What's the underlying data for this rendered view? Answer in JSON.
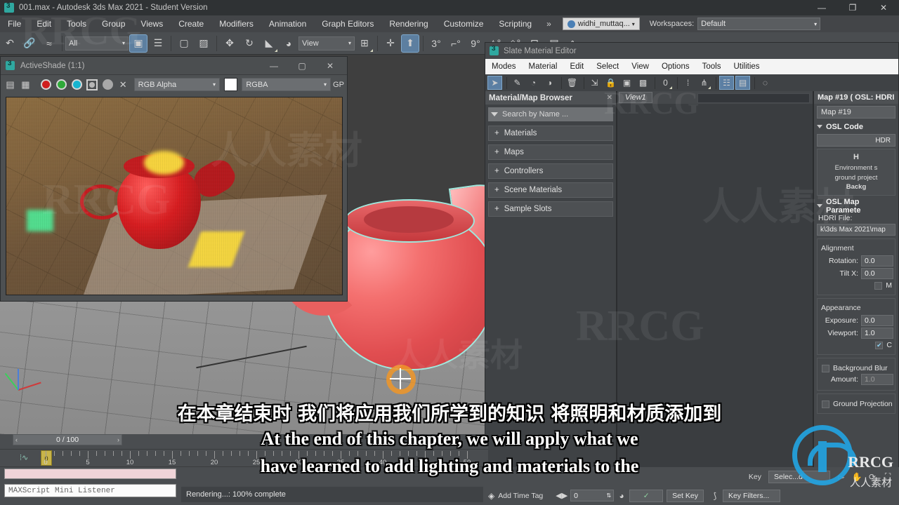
{
  "window": {
    "title": "001.max - Autodesk 3ds Max 2021 - Student Version",
    "minimize": "—",
    "maximize": "❐",
    "close": "✕"
  },
  "menubar": {
    "items": [
      "File",
      "Edit",
      "Tools",
      "Group",
      "Views",
      "Create",
      "Modifiers",
      "Animation",
      "Graph Editors",
      "Rendering",
      "Customize",
      "Scripting"
    ],
    "overflow": "»",
    "user": "widhi_muttaq...",
    "user_arrow": "▾",
    "workspaces_label": "Workspaces:",
    "workspace_value": "Default",
    "workspace_arrow": "▾"
  },
  "main_toolbar": {
    "selection_filter": "All",
    "filter_arrow": "▾",
    "reference_coordinate": "View",
    "coord_arrow": "▾",
    "icons": [
      "undo-icon",
      "redo-icon",
      "select-link-icon",
      "unlink-icon",
      "bind-space-warp-icon",
      "select-object-icon",
      "select-by-name-icon",
      "rectangular-region-icon",
      "window-crossing-icon",
      "select-move-icon",
      "select-rotate-icon",
      "select-scale-icon",
      "placement-icon",
      "use-center-icon",
      "select-manipulate-icon",
      "snap-toggle-icon",
      "angle-snap-icon",
      "percent-snap-icon",
      "spinner-snap-icon"
    ]
  },
  "activeshade": {
    "title": "ActiveShade (1:1)",
    "minimize": "—",
    "maximize": "▢",
    "close": "✕",
    "toolbar": {
      "save_icon": "save-image-icon",
      "clone_icon": "clone-rendered-frame-icon",
      "channel_red": "red-channel-toggle",
      "channel_green": "green-channel-toggle",
      "channel_blue": "blue-channel-toggle",
      "channel_mono": "monochrome-toggle",
      "channel_alpha": "alpha-toggle",
      "clear_icon": "✕",
      "channel_select": "RGB Alpha",
      "channel_arrow": "▾",
      "color_swatch": "#ffffff",
      "layer_select": "RGBA",
      "layer_arrow": "▾",
      "extra_label": "GP"
    }
  },
  "slate_editor": {
    "title": "Slate Material Editor",
    "menu": [
      "Modes",
      "Material",
      "Edit",
      "Select",
      "View",
      "Options",
      "Tools",
      "Utilities"
    ],
    "toolbar_icons": [
      "select-cursor-icon",
      "pick-material-icon",
      "assign-material-icon",
      "show-in-viewport-icon",
      "delete-icon",
      "move-children-icon",
      "lock-icon",
      "material-id-icon",
      "show-background-icon",
      "show-map-icon",
      "layout-children-icon",
      "layout-icon",
      "navigator-icon",
      "parameter-editor-icon",
      "select-by-material-icon"
    ],
    "browser": {
      "title": "Material/Map Browser",
      "close": "✕",
      "search_placeholder": "Search by Name ...",
      "groups": [
        "Materials",
        "Maps",
        "Controllers",
        "Scene Materials",
        "Sample Slots"
      ],
      "expand_glyph": "+"
    },
    "view": {
      "tab": "View1"
    },
    "properties": {
      "header": "Map #19  ( OSL: HDRI",
      "name_value": "Map #19",
      "rollouts": {
        "osl_code": {
          "title": "OSL Code",
          "button": "HDR",
          "note_title": "H",
          "note_lines": [
            "Environment s",
            "ground project",
            "Backg"
          ]
        },
        "osl_map_parameters": {
          "title": "OSL Map Paramete",
          "hdri_label": "HDRI File:",
          "hdri_value": "k\\3ds Max 2021\\map",
          "alignment_label": "Alignment",
          "rotation_label": "Rotation:",
          "rotation_value": "0.0",
          "tiltx_label": "Tilt X:",
          "tiltx_value": "0.0",
          "mirror_label": "M",
          "appearance_label": "Appearance",
          "exposure_label": "Exposure:",
          "exposure_value": "0.0",
          "viewport_label": "Viewport:",
          "viewport_value": "1.0",
          "clamp_label": "C",
          "background_blur_label": "Background Blur",
          "amount_label": "Amount:",
          "amount_value": "1.0",
          "ground_projection_label": "Ground Projection"
        }
      }
    }
  },
  "timeline": {
    "frame_display": "0 / 100",
    "prev_arrow": "‹",
    "next_arrow": "›",
    "ticks": [
      0,
      5,
      10,
      15,
      20,
      25,
      30,
      35,
      40,
      45,
      50
    ],
    "slider_value": "0"
  },
  "bottom": {
    "mini_listener_placeholder": "MAXScript Mini Listener",
    "status_text": "Rendering...: 100% complete",
    "add_time_tag": "Add Time Tag",
    "time_tag_icon": "cube-icon",
    "current_frame": "0",
    "key_label": "Key",
    "selected_label": "Selec...d",
    "set_key_button": "Set Key",
    "key_filters_button": "Key Filters...",
    "auto_key_icon": "auto-key-icon",
    "set_key_mode_icon": "set-key-mode-icon",
    "nav_icons": [
      "zoom-icon",
      "pan-icon",
      "orbit-icon",
      "maximize-viewport-icon"
    ]
  },
  "subtitles": {
    "chinese": "在本章结束时 我们将应用我们所学到的知识 将照明和材质添加到",
    "english_line1": "At the end of this chapter, we will apply what we",
    "english_line2": "have learned to add lighting and materials to the"
  },
  "watermark": {
    "text_rrcg": "RRCG",
    "text_cn": "人人素材"
  },
  "colors": {
    "accent_blue": "#5c7fa3",
    "teal_logo": "#2fa8a0",
    "brand_blue": "#23a3e0",
    "teapot_red": "#e04d50",
    "selection_outline": "#9fe8dd"
  }
}
